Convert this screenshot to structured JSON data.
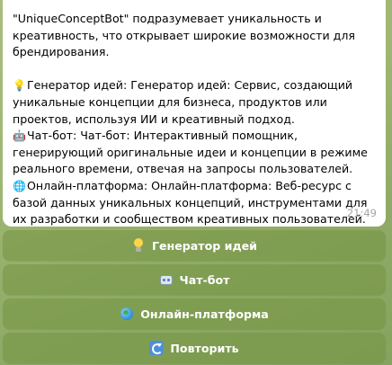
{
  "message": {
    "intro": "\"UniqueConceptBot\" подразумевает уникальность и креативность, что открывает широкие возможности для брендирования.",
    "items": [
      {
        "icon": "light-bulb-icon",
        "text": "Генератор идей:  Генератор идей:  Сервис, создающий уникальные концепции для бизнеса, продуктов или проектов, используя ИИ и креативный подход."
      },
      {
        "icon": "robot-icon",
        "text": "Чат-бот:  Чат-бот: Интерактивный помощник, генерирующий оригинальные идеи и концепции в режиме реального времени, отвечая на запросы пользователей."
      },
      {
        "icon": "globe-icon",
        "text": "Онлайн-платформа:  Онлайн-платформа:  Веб-ресурс с базой данных уникальных концепций, инструментами для их разработки и сообществом креативных пользователей."
      }
    ],
    "time": "21:49"
  },
  "keyboard": {
    "buttons": [
      {
        "label": "Генератор идей",
        "icon": "light-bulb-icon"
      },
      {
        "label": "Чат-бот",
        "icon": "robot-icon"
      },
      {
        "label": "Онлайн-платформа",
        "icon": "globe-icon"
      },
      {
        "label": "Повторить",
        "icon": "repeat-icon"
      }
    ]
  },
  "colors": {
    "bubble": "#ffffff",
    "button": "#7f9a4c",
    "time": "#a6a6a6"
  }
}
